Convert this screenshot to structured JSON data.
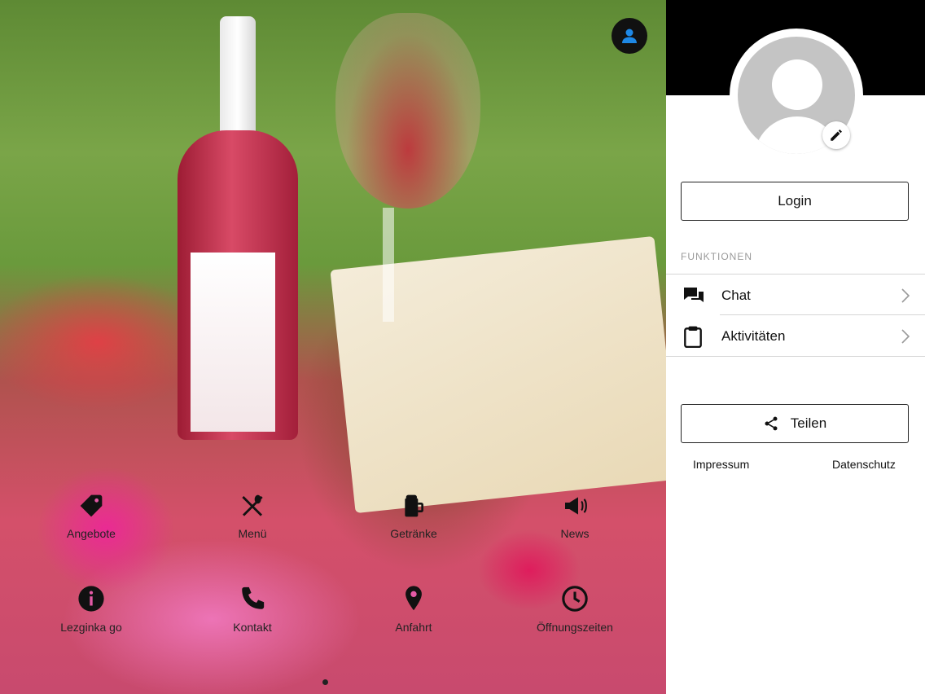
{
  "main": {
    "tiles": [
      {
        "label": "Angebote",
        "icon": "tag-icon"
      },
      {
        "label": "Menü",
        "icon": "cutlery-icon"
      },
      {
        "label": "Getränke",
        "icon": "beer-mug-icon"
      },
      {
        "label": "News",
        "icon": "megaphone-icon"
      },
      {
        "label": "Lezginka go",
        "icon": "info-icon"
      },
      {
        "label": "Kontakt",
        "icon": "phone-icon"
      },
      {
        "label": "Anfahrt",
        "icon": "map-pin-icon"
      },
      {
        "label": "Öffnungszeiten",
        "icon": "clock-icon"
      }
    ]
  },
  "sidebar": {
    "login_label": "Login",
    "section_title": "FUNKTIONEN",
    "items": [
      {
        "label": "Chat",
        "icon": "chat-icon"
      },
      {
        "label": "Aktivitäten",
        "icon": "clipboard-icon"
      }
    ],
    "share_label": "Teilen",
    "footer_links": [
      "Impressum",
      "Datenschutz"
    ]
  },
  "colors": {
    "accent": "#1e88e5",
    "topbar": "#000000",
    "text": "#111111"
  }
}
